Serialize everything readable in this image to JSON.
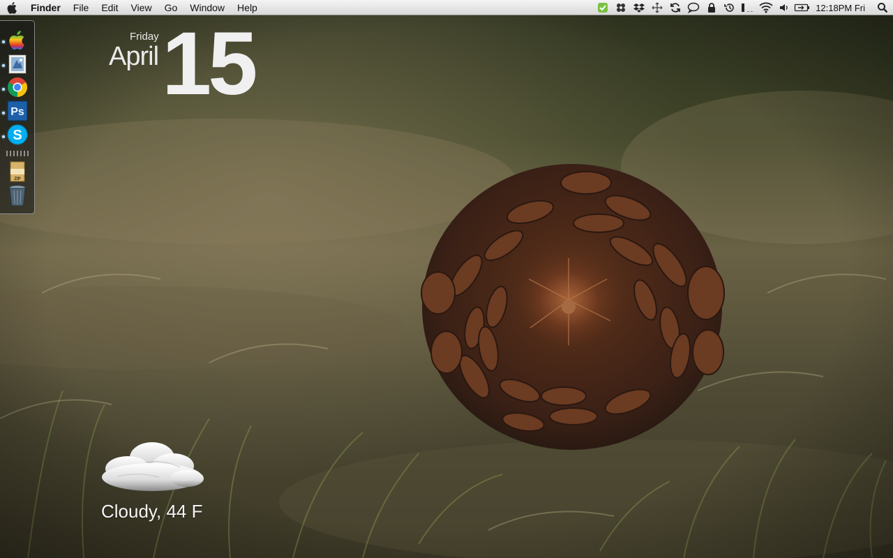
{
  "menubar": {
    "app_name": "Finder",
    "menus": [
      "File",
      "Edit",
      "View",
      "Go",
      "Window",
      "Help"
    ],
    "extras_icons": [
      "evernote-icon",
      "flower-icon",
      "dropbox-icon",
      "move-icon",
      "sync-icon",
      "chat-bubble-icon",
      "lock-icon",
      "time-machine-icon",
      "battery-status-icon",
      "wifi-icon",
      "volume-icon",
      "battery-icon"
    ],
    "clock": "12:18PM Fri",
    "spotlight_icon": "spotlight-search-icon"
  },
  "dock": {
    "items": [
      {
        "name": "finder",
        "icon": "apple-logo-icon",
        "running": true
      },
      {
        "name": "mail",
        "icon": "mail-stamp-icon",
        "running": true
      },
      {
        "name": "chrome",
        "icon": "chrome-icon",
        "running": true
      },
      {
        "name": "photoshop",
        "icon": "photoshop-icon",
        "label": "Ps",
        "running": true
      },
      {
        "name": "skype",
        "icon": "skype-icon",
        "label": "S",
        "running": true
      },
      {
        "name": "zip-archive",
        "icon": "zip-archive-icon",
        "label": "ZIP",
        "running": false
      },
      {
        "name": "trash",
        "icon": "trash-icon",
        "running": false
      }
    ]
  },
  "date_widget": {
    "day": "Friday",
    "month": "April",
    "date": "15"
  },
  "weather_widget": {
    "icon": "cloud-icon",
    "text": "Cloudy, 44 F"
  },
  "colors": {
    "menubar_top": "#f4f4f4",
    "menubar_bottom": "#d9d9d9",
    "photoshop_blue": "#1d5fa8",
    "skype_blue": "#00aff0",
    "evernote_green": "#7ac142"
  }
}
